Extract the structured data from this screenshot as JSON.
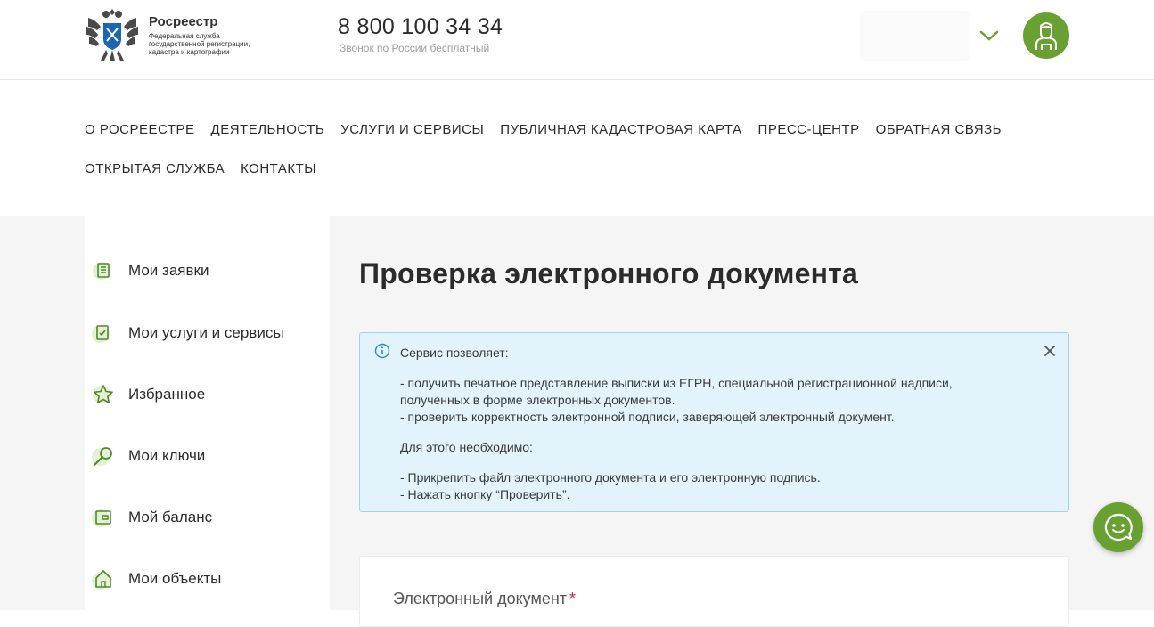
{
  "header": {
    "logo_title": "Росреестр",
    "logo_subtitle": "Федеральная служба государственной регистрации, кадастра и картографии",
    "phone": "8 800 100 34 34",
    "phone_note": "Звонок по России бесплатный"
  },
  "nav": {
    "row1": [
      "О РОСРЕЕСТРЕ",
      "ДЕЯТЕЛЬНОСТЬ",
      "УСЛУГИ И СЕРВИСЫ",
      "ПУБЛИЧНАЯ КАДАСТРОВАЯ КАРТА",
      "ПРЕСС-ЦЕНТР",
      "ОБРАТНАЯ СВЯЗЬ"
    ],
    "row2": [
      "ОТКРЫТАЯ СЛУЖБА",
      "КОНТАКТЫ"
    ]
  },
  "sidebar": {
    "items": [
      {
        "label": "Мои заявки",
        "icon": "document-icon"
      },
      {
        "label": "Мои услуги и сервисы",
        "icon": "checklist-icon"
      },
      {
        "label": "Избранное",
        "icon": "star-icon"
      },
      {
        "label": "Мои ключи",
        "icon": "key-icon"
      },
      {
        "label": "Мой баланс",
        "icon": "wallet-icon"
      },
      {
        "label": "Мои объекты",
        "icon": "house-icon"
      }
    ]
  },
  "main": {
    "title": "Проверка электронного документа",
    "info": {
      "heading": "Сервис позволяет:",
      "line1": "- получить печатное представление выписки из ЕГРН, специальной регистрационной надписи, полученных в форме электронных документов.",
      "line2": "- проверить корректность электронной подписи, заверяющей электронный документ.",
      "need": "Для этого необходимо:",
      "step1": "- Прикрепить файл электронного документа и его электронную подпись.",
      "step2": "- Нажать кнопку “Проверить”."
    },
    "form": {
      "doc_label": "Электронный документ",
      "required_mark": "*"
    }
  },
  "colors": {
    "brand_green": "#68a131",
    "info_bg": "#e3f3fb",
    "info_border": "#9fd3ec",
    "required": "#d9232e"
  }
}
